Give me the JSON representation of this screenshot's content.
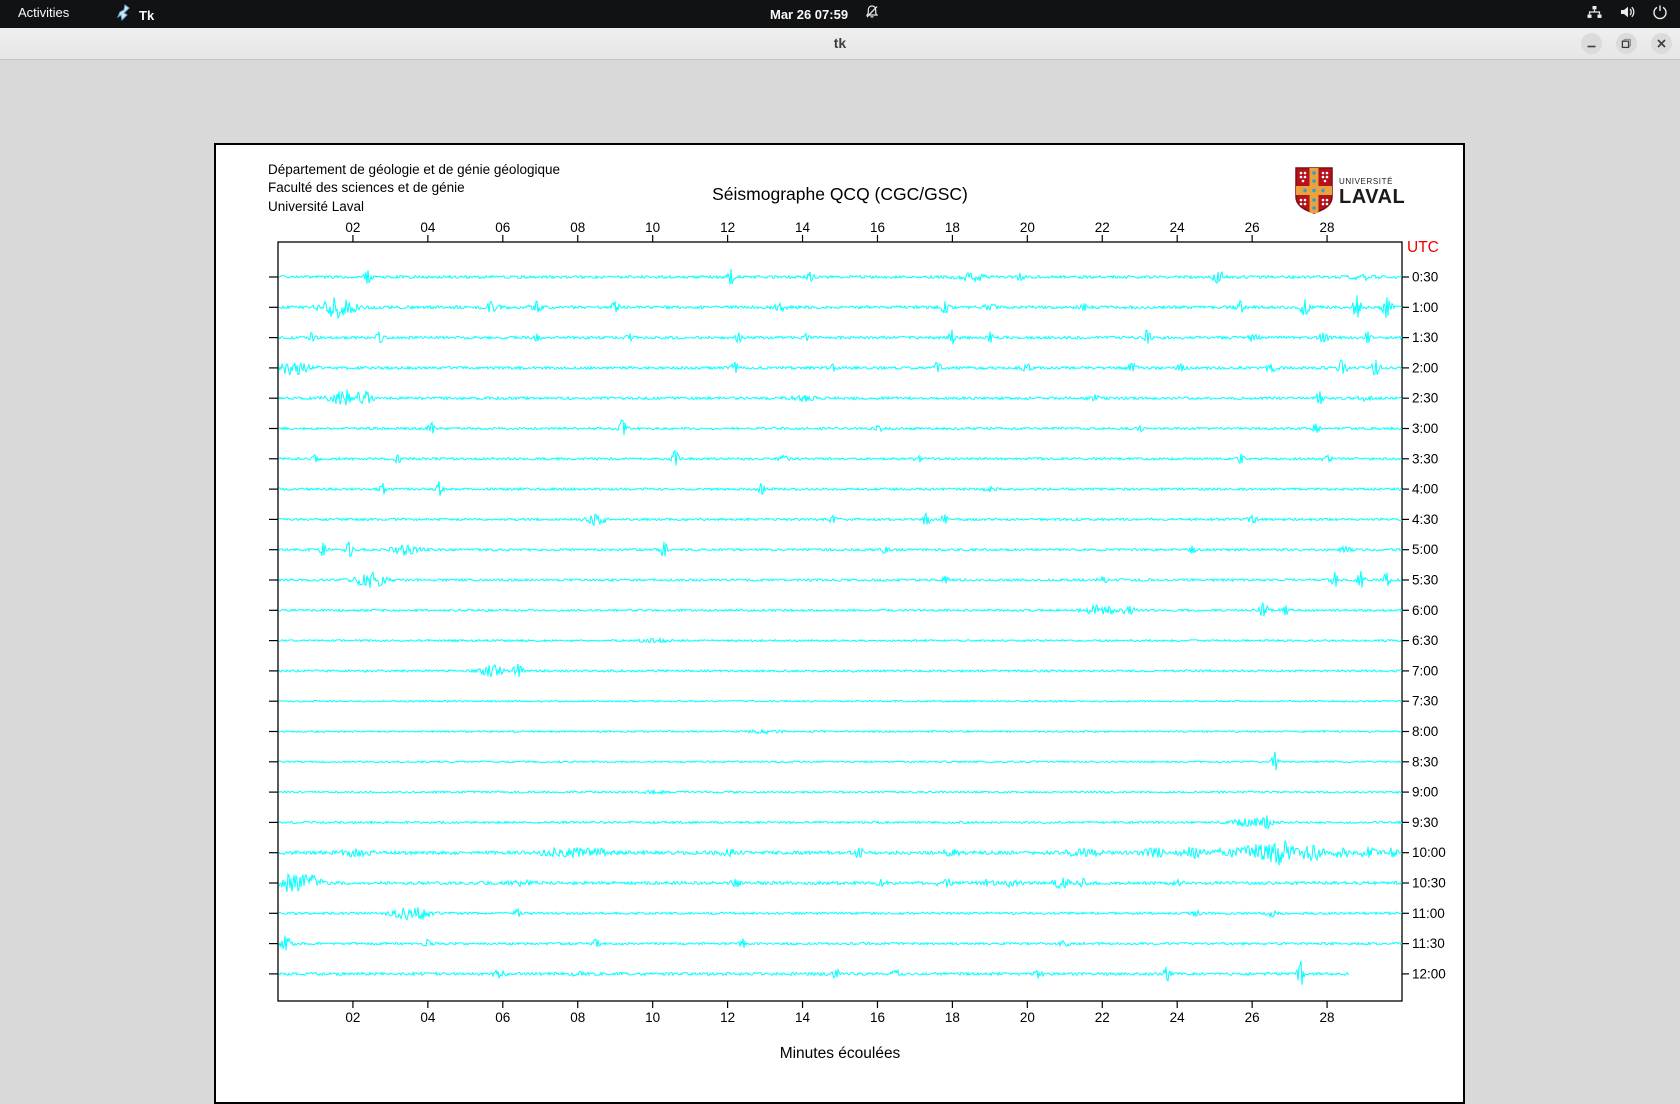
{
  "topbar": {
    "activities": "Activities",
    "app_name": "Tk",
    "clock": "Mar 26  07:59",
    "icons": [
      "tk-icon",
      "notifications-disabled-icon",
      "network-wired-icon",
      "volume-icon",
      "power-icon"
    ]
  },
  "titlebar": {
    "title": "tk",
    "buttons": [
      "minimize",
      "maximize",
      "close"
    ]
  },
  "header": {
    "line1": "Département de géologie et de génie géologique",
    "line2": "Faculté des sciences et de génie",
    "line3": "Université Laval"
  },
  "logo": {
    "line1": "UNIVERSITÉ",
    "line2": "LAVAL",
    "shield_colors": {
      "field": "#b5121b",
      "cross": "#e8a33d",
      "dots_blue": "#2a9fd8",
      "dots_white": "#ffffff"
    }
  },
  "colors": {
    "trace": "#00ffff",
    "axis": "#000000",
    "utc_label": "#f20000",
    "canvas_bg": "#ffffff",
    "app_bg": "#d9d9d9"
  },
  "chart_data": {
    "type": "line",
    "title": "Séismographe QCQ (CGC/GSC)",
    "xlabel": "Minutes écoulées",
    "right_axis_title": "UTC",
    "x_range": [
      0,
      30
    ],
    "x_ticks": [
      "02",
      "04",
      "06",
      "08",
      "10",
      "12",
      "14",
      "16",
      "18",
      "20",
      "22",
      "24",
      "26",
      "28"
    ],
    "x_tick_minutes": [
      2,
      4,
      6,
      8,
      10,
      12,
      14,
      16,
      18,
      20,
      22,
      24,
      26,
      28
    ],
    "grid": false,
    "trace_color": "#00ffff",
    "traces": [
      {
        "label": "0:30",
        "base": 1.4,
        "end": 30,
        "events": [
          [
            2.4,
            7,
            0.06
          ],
          [
            12.1,
            8,
            0.06
          ],
          [
            14.2,
            5,
            0.06
          ],
          [
            18.5,
            4,
            0.25
          ],
          [
            19.8,
            4,
            0.06
          ],
          [
            25.1,
            5,
            0.12
          ],
          [
            29.0,
            3,
            0.2
          ]
        ]
      },
      {
        "label": "1:00",
        "base": 1.5,
        "end": 30,
        "events": [
          [
            1.6,
            10,
            0.3
          ],
          [
            5.7,
            5,
            0.15
          ],
          [
            6.9,
            6,
            0.1
          ],
          [
            9.0,
            6,
            0.06
          ],
          [
            13.4,
            4,
            0.1
          ],
          [
            17.8,
            6,
            0.06
          ],
          [
            19.0,
            3,
            0.1
          ],
          [
            21.5,
            4,
            0.06
          ],
          [
            25.7,
            6,
            0.06
          ],
          [
            27.4,
            8,
            0.08
          ],
          [
            28.8,
            12,
            0.08
          ],
          [
            29.6,
            10,
            0.08
          ]
        ]
      },
      {
        "label": "1:30",
        "base": 1.4,
        "end": 30,
        "events": [
          [
            0.9,
            4,
            0.06
          ],
          [
            2.7,
            6,
            0.06
          ],
          [
            6.9,
            4,
            0.06
          ],
          [
            9.4,
            4,
            0.06
          ],
          [
            12.3,
            5,
            0.06
          ],
          [
            14.1,
            4,
            0.06
          ],
          [
            18.0,
            8,
            0.08
          ],
          [
            19.0,
            6,
            0.06
          ],
          [
            23.2,
            7,
            0.06
          ],
          [
            26.0,
            3,
            0.1
          ],
          [
            27.9,
            5,
            0.08
          ],
          [
            29.1,
            6,
            0.08
          ]
        ]
      },
      {
        "label": "2:00",
        "base": 1.4,
        "end": 30,
        "events": [
          [
            0.4,
            6,
            0.3
          ],
          [
            12.2,
            6,
            0.06
          ],
          [
            14.8,
            4,
            0.06
          ],
          [
            17.6,
            5,
            0.06
          ],
          [
            20.0,
            3,
            0.1
          ],
          [
            22.8,
            4,
            0.1
          ],
          [
            24.1,
            4,
            0.06
          ],
          [
            26.5,
            4,
            0.1
          ],
          [
            28.4,
            7,
            0.08
          ],
          [
            29.3,
            8,
            0.08
          ]
        ]
      },
      {
        "label": "2:30",
        "base": 1.3,
        "end": 30,
        "events": [
          [
            1.8,
            8,
            0.3
          ],
          [
            2.4,
            6,
            0.1
          ],
          [
            14.0,
            2.5,
            0.2
          ],
          [
            21.8,
            3,
            0.1
          ],
          [
            27.8,
            7,
            0.06
          ],
          [
            29.0,
            3,
            0.1
          ]
        ]
      },
      {
        "label": "3:00",
        "base": 1.2,
        "end": 30,
        "events": [
          [
            4.1,
            6,
            0.06
          ],
          [
            9.2,
            8,
            0.06
          ],
          [
            16.0,
            2.5,
            0.1
          ],
          [
            23.0,
            3.5,
            0.08
          ],
          [
            27.7,
            5,
            0.06
          ]
        ]
      },
      {
        "label": "3:30",
        "base": 1.2,
        "end": 30,
        "events": [
          [
            1.0,
            4,
            0.06
          ],
          [
            3.2,
            4,
            0.08
          ],
          [
            10.6,
            8,
            0.06
          ],
          [
            13.5,
            3,
            0.08
          ],
          [
            17.1,
            3,
            0.08
          ],
          [
            25.7,
            5,
            0.06
          ],
          [
            28.0,
            3,
            0.1
          ]
        ]
      },
      {
        "label": "4:00",
        "base": 1.2,
        "end": 30,
        "events": [
          [
            2.8,
            6,
            0.06
          ],
          [
            4.3,
            8,
            0.06
          ],
          [
            12.9,
            6,
            0.06
          ],
          [
            19.0,
            2.5,
            0.1
          ]
        ]
      },
      {
        "label": "4:30",
        "base": 1.2,
        "end": 30,
        "events": [
          [
            8.5,
            5,
            0.2
          ],
          [
            14.8,
            4,
            0.06
          ],
          [
            17.3,
            6,
            0.06
          ],
          [
            17.8,
            5,
            0.06
          ],
          [
            26.0,
            4,
            0.08
          ]
        ]
      },
      {
        "label": "5:00",
        "base": 1.2,
        "end": 30,
        "events": [
          [
            1.2,
            7,
            0.06
          ],
          [
            1.9,
            8,
            0.06
          ],
          [
            3.4,
            5,
            0.25
          ],
          [
            10.3,
            8,
            0.06
          ],
          [
            16.2,
            3,
            0.08
          ],
          [
            24.4,
            4,
            0.06
          ],
          [
            28.5,
            3,
            0.1
          ]
        ]
      },
      {
        "label": "5:30",
        "base": 1.2,
        "end": 30,
        "events": [
          [
            2.5,
            7,
            0.3
          ],
          [
            17.8,
            4,
            0.06
          ],
          [
            22.0,
            2.5,
            0.1
          ],
          [
            28.2,
            8,
            0.06
          ],
          [
            28.9,
            9,
            0.06
          ],
          [
            29.6,
            7,
            0.06
          ]
        ]
      },
      {
        "label": "6:00",
        "base": 1.1,
        "end": 30,
        "events": [
          [
            22.0,
            5,
            0.3
          ],
          [
            22.7,
            4,
            0.1
          ],
          [
            26.3,
            7,
            0.08
          ],
          [
            26.9,
            5,
            0.08
          ]
        ]
      },
      {
        "label": "6:30",
        "base": 1.0,
        "end": 30,
        "events": [
          [
            10.0,
            1.5,
            0.3
          ]
        ]
      },
      {
        "label": "7:00",
        "base": 1.1,
        "end": 30,
        "events": [
          [
            5.7,
            6,
            0.2
          ],
          [
            6.4,
            7,
            0.08
          ]
        ]
      },
      {
        "label": "7:30",
        "base": 0.8,
        "end": 30,
        "events": []
      },
      {
        "label": "8:00",
        "base": 0.9,
        "end": 30,
        "events": [
          [
            13.0,
            1.3,
            0.3
          ]
        ]
      },
      {
        "label": "8:30",
        "base": 0.9,
        "end": 30,
        "events": [
          [
            26.6,
            10,
            0.06
          ]
        ]
      },
      {
        "label": "9:00",
        "base": 1.0,
        "end": 30,
        "events": [
          [
            10.0,
            1.3,
            0.2
          ]
        ]
      },
      {
        "label": "9:30",
        "base": 1.1,
        "end": 30,
        "events": [
          [
            25.9,
            4,
            0.3
          ],
          [
            26.4,
            7,
            0.08
          ]
        ]
      },
      {
        "label": "10:00",
        "base": 1.8,
        "end": 30,
        "events": [
          [
            2.0,
            2.5,
            0.3
          ],
          [
            7.6,
            3.5,
            0.4
          ],
          [
            8.4,
            3.5,
            0.3
          ],
          [
            12.0,
            2.5,
            0.2
          ],
          [
            15.5,
            5,
            0.08
          ],
          [
            18.0,
            2.5,
            0.2
          ],
          [
            21.5,
            3.5,
            0.3
          ],
          [
            23.4,
            4,
            0.2
          ],
          [
            24.4,
            5,
            0.2
          ],
          [
            25.3,
            4,
            0.2
          ],
          [
            26.1,
            7,
            0.3
          ],
          [
            26.8,
            11,
            0.25
          ],
          [
            27.6,
            7,
            0.2
          ],
          [
            28.4,
            5,
            0.15
          ],
          [
            29.1,
            6,
            0.12
          ],
          [
            29.7,
            5,
            0.1
          ]
        ]
      },
      {
        "label": "10:30",
        "base": 1.6,
        "end": 30,
        "events": [
          [
            0.3,
            8,
            0.3
          ],
          [
            0.9,
            6,
            0.2
          ],
          [
            6.5,
            2.5,
            0.2
          ],
          [
            12.2,
            4,
            0.08
          ],
          [
            16.1,
            4,
            0.08
          ],
          [
            17.8,
            3.5,
            0.15
          ],
          [
            18.9,
            4,
            0.12
          ],
          [
            19.6,
            3.5,
            0.12
          ],
          [
            20.9,
            4,
            0.15
          ],
          [
            21.5,
            3.5,
            0.12
          ],
          [
            24.0,
            2.5,
            0.1
          ]
        ]
      },
      {
        "label": "11:00",
        "base": 1.2,
        "end": 30,
        "events": [
          [
            3.5,
            6,
            0.3
          ],
          [
            3.9,
            4,
            0.1
          ],
          [
            6.4,
            4,
            0.08
          ],
          [
            24.5,
            2.5,
            0.1
          ],
          [
            26.5,
            3,
            0.08
          ]
        ]
      },
      {
        "label": "11:30",
        "base": 1.2,
        "end": 30,
        "events": [
          [
            0.2,
            8,
            0.1
          ],
          [
            4.0,
            3.5,
            0.08
          ],
          [
            8.5,
            4,
            0.06
          ],
          [
            12.4,
            5,
            0.06
          ],
          [
            21.0,
            2.5,
            0.1
          ]
        ]
      },
      {
        "label": "12:00",
        "base": 1.5,
        "end": 28.6,
        "events": [
          [
            5.9,
            3.5,
            0.1
          ],
          [
            8.0,
            2.5,
            0.1
          ],
          [
            14.9,
            4,
            0.08
          ],
          [
            16.5,
            3,
            0.08
          ],
          [
            20.3,
            3.5,
            0.08
          ],
          [
            23.7,
            7,
            0.08
          ],
          [
            27.3,
            13,
            0.06
          ]
        ]
      }
    ]
  }
}
